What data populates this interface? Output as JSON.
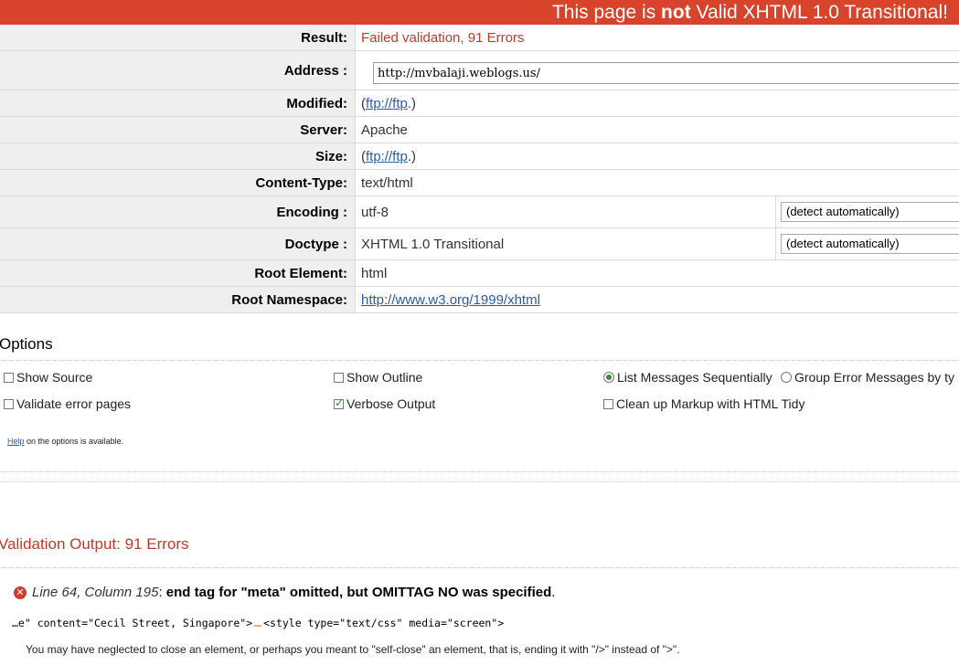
{
  "banner": {
    "prefix": "This page is ",
    "emph": "not",
    "suffix": " Valid XHTML 1.0 Transitional!"
  },
  "meta": {
    "result": {
      "label": "Result:",
      "value": "Failed validation, 91 Errors"
    },
    "address": {
      "label": "Address :",
      "value": "http://mvbalaji.weblogs.us/"
    },
    "modified": {
      "label": "Modified:",
      "open": "(",
      "link": "ftp://ftp",
      "close": ".)"
    },
    "server": {
      "label": "Server:",
      "value": "Apache"
    },
    "size": {
      "label": "Size:",
      "open": "(",
      "link": "ftp://ftp",
      "close": ".)"
    },
    "content_type": {
      "label": "Content-Type:",
      "value": "text/html"
    },
    "encoding": {
      "label": "Encoding :",
      "value": "utf-8",
      "select": "(detect automatically)"
    },
    "doctype": {
      "label": "Doctype :",
      "value": "XHTML 1.0 Transitional",
      "select": "(detect automatically)"
    },
    "root_element": {
      "label": "Root Element:",
      "value": "html"
    },
    "root_namespace": {
      "label": "Root Namespace:",
      "link": "http://www.w3.org/1999/xhtml"
    }
  },
  "options": {
    "title": "Options",
    "show_source": "Show Source",
    "show_outline": "Show Outline",
    "list_sequential": "List Messages Sequentially",
    "group_errors": "Group Error Messages by ty",
    "validate_error_pages": "Validate error pages",
    "verbose_output": "Verbose Output",
    "tidy": "Clean up Markup with HTML Tidy",
    "help_link": "Help",
    "help_text": " on the options is available."
  },
  "output": {
    "title": "Validation Output: 91 Errors",
    "error": {
      "location": "Line 64, Column 195",
      "sep": ": ",
      "message": "end tag for \"meta\" omitted, but OMITTAG NO was specified",
      "dot": ".",
      "source_before": "…e\" content=\"Cecil Street, Singapore\">",
      "source_after": "<style type=\"text/css\" media=\"screen\">",
      "explanation": "You may have neglected to close an element, or perhaps you meant to \"self-close\" an element, that is, ending it with \"/>\" instead of \">\"."
    }
  }
}
